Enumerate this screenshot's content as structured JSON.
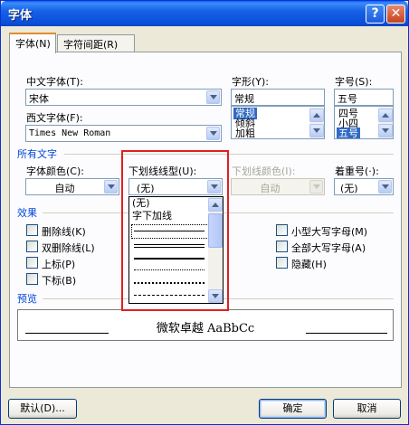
{
  "window": {
    "title": "字体",
    "help_label": "?",
    "close_label": "✕"
  },
  "tabs": [
    {
      "label": "字体(N)",
      "active": true
    },
    {
      "label": "字符间距(R)",
      "active": false
    }
  ],
  "font": {
    "chinese_label": "中文字体(T):",
    "chinese_value": "宋体",
    "western_label": "西文字体(F):",
    "western_value": "Times New Roman",
    "style_label": "字形(Y):",
    "style_value": "常规",
    "style_options": [
      "常规",
      "倾斜",
      "加粗"
    ],
    "size_label": "字号(S):",
    "size_value": "五号",
    "size_options": [
      "四号",
      "小四",
      "五号"
    ]
  },
  "all_text": {
    "section_label": "所有文字",
    "color_label": "字体颜色(C):",
    "color_value": "自动",
    "underline_label": "下划线线型(U):",
    "underline_value": "(无)",
    "underline_color_label": "下划线颜色(I):",
    "underline_color_value": "自动",
    "emphasis_label": "着重号(·):",
    "emphasis_value": "(无)"
  },
  "underline_dropdown": {
    "text_items": [
      "(无)",
      "字下加线"
    ],
    "line_styles": [
      "single",
      "double",
      "thick",
      "dotted",
      "dotted-heavy",
      "dashed"
    ]
  },
  "effects": {
    "section_label": "效果",
    "left": [
      "删除线(K)",
      "双删除线(L)",
      "上标(P)",
      "下标(B)"
    ],
    "right": [
      "小型大写字母(M)",
      "全部大写字母(A)",
      "隐藏(H)"
    ]
  },
  "preview": {
    "section_label": "预览",
    "text": "微软卓越 AaBbCc"
  },
  "buttons": {
    "default": "默认(D)...",
    "ok": "确定",
    "cancel": "取消"
  },
  "colors": {
    "title_blue": "#0a5cf4",
    "section_blue": "#0046d5",
    "selection": "#316ac5",
    "highlight_red": "#e02020"
  }
}
